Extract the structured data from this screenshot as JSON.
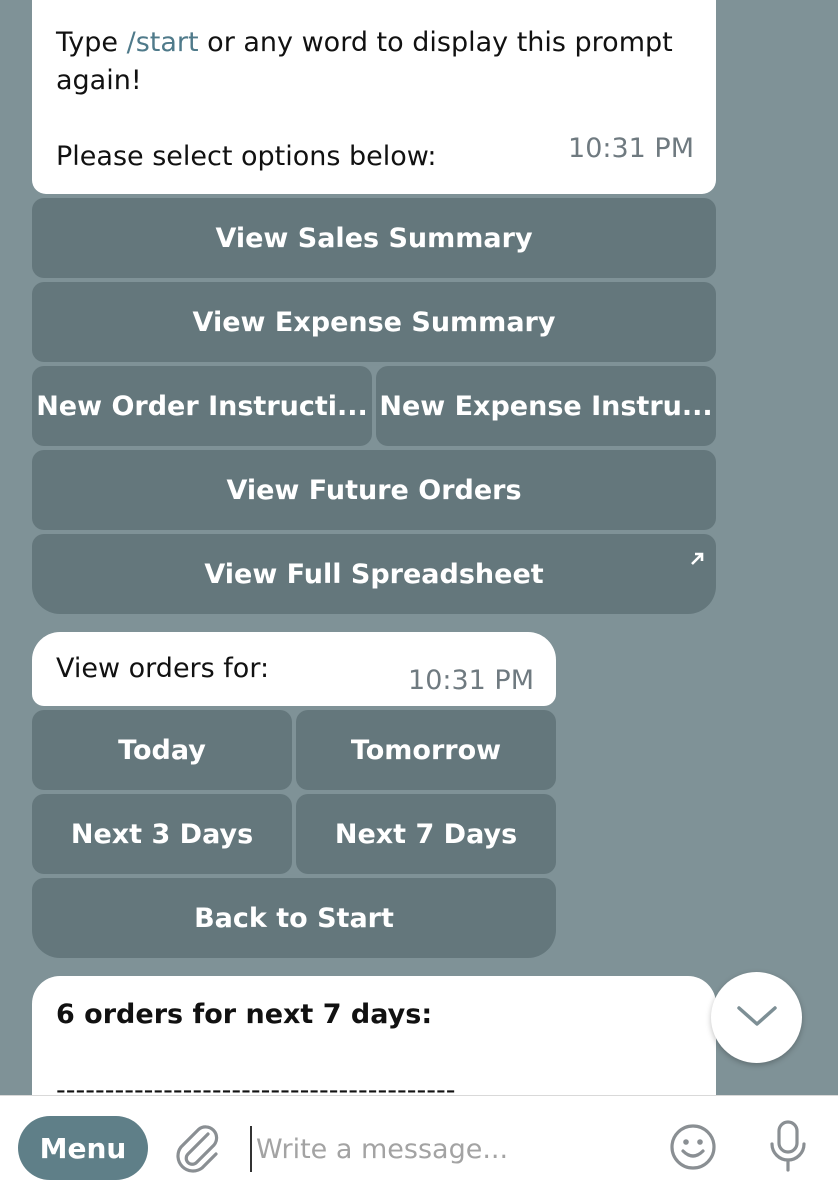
{
  "messages": {
    "first": {
      "line1_prefix": "Type ",
      "line1_link": "/start",
      "line1_suffix": " or any word to display this prompt",
      "line2": "again!",
      "line3": "Please select options below:",
      "time": "10:31 PM"
    },
    "second": {
      "text": "View orders for:",
      "time": "10:31 PM"
    },
    "third": {
      "title": "6 orders for next 7 days:",
      "divider": "------------------------------------------"
    }
  },
  "keyboard1": {
    "view_sales": "View Sales Summary",
    "view_expense": "View Expense Summary",
    "new_order": "New Order Instructi...",
    "new_expense": "New Expense Instru...",
    "view_future": "View Future Orders",
    "view_full": "View Full Spreadsheet"
  },
  "keyboard2": {
    "today": "Today",
    "tomorrow": "Tomorrow",
    "next3": "Next 3 Days",
    "next7": "Next 7 Days",
    "back": "Back to Start"
  },
  "composer": {
    "menu_label": "Menu",
    "placeholder": "Write a message..."
  },
  "icons": {
    "attach": "paperclip-icon",
    "emoji": "smiley-icon",
    "mic": "microphone-icon",
    "scroll": "chevron-down-icon",
    "external": "arrow-up-right-icon"
  }
}
